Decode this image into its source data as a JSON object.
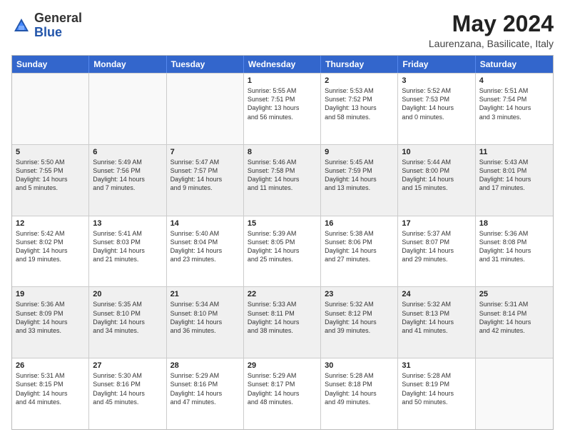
{
  "logo": {
    "general": "General",
    "blue": "Blue"
  },
  "title": "May 2024",
  "subtitle": "Laurenzana, Basilicate, Italy",
  "header_days": [
    "Sunday",
    "Monday",
    "Tuesday",
    "Wednesday",
    "Thursday",
    "Friday",
    "Saturday"
  ],
  "rows": [
    [
      {
        "day": "",
        "info": "",
        "empty": true
      },
      {
        "day": "",
        "info": "",
        "empty": true
      },
      {
        "day": "",
        "info": "",
        "empty": true
      },
      {
        "day": "1",
        "info": "Sunrise: 5:55 AM\nSunset: 7:51 PM\nDaylight: 13 hours\nand 56 minutes."
      },
      {
        "day": "2",
        "info": "Sunrise: 5:53 AM\nSunset: 7:52 PM\nDaylight: 13 hours\nand 58 minutes."
      },
      {
        "day": "3",
        "info": "Sunrise: 5:52 AM\nSunset: 7:53 PM\nDaylight: 14 hours\nand 0 minutes."
      },
      {
        "day": "4",
        "info": "Sunrise: 5:51 AM\nSunset: 7:54 PM\nDaylight: 14 hours\nand 3 minutes."
      }
    ],
    [
      {
        "day": "5",
        "info": "Sunrise: 5:50 AM\nSunset: 7:55 PM\nDaylight: 14 hours\nand 5 minutes."
      },
      {
        "day": "6",
        "info": "Sunrise: 5:49 AM\nSunset: 7:56 PM\nDaylight: 14 hours\nand 7 minutes."
      },
      {
        "day": "7",
        "info": "Sunrise: 5:47 AM\nSunset: 7:57 PM\nDaylight: 14 hours\nand 9 minutes."
      },
      {
        "day": "8",
        "info": "Sunrise: 5:46 AM\nSunset: 7:58 PM\nDaylight: 14 hours\nand 11 minutes."
      },
      {
        "day": "9",
        "info": "Sunrise: 5:45 AM\nSunset: 7:59 PM\nDaylight: 14 hours\nand 13 minutes."
      },
      {
        "day": "10",
        "info": "Sunrise: 5:44 AM\nSunset: 8:00 PM\nDaylight: 14 hours\nand 15 minutes."
      },
      {
        "day": "11",
        "info": "Sunrise: 5:43 AM\nSunset: 8:01 PM\nDaylight: 14 hours\nand 17 minutes."
      }
    ],
    [
      {
        "day": "12",
        "info": "Sunrise: 5:42 AM\nSunset: 8:02 PM\nDaylight: 14 hours\nand 19 minutes."
      },
      {
        "day": "13",
        "info": "Sunrise: 5:41 AM\nSunset: 8:03 PM\nDaylight: 14 hours\nand 21 minutes."
      },
      {
        "day": "14",
        "info": "Sunrise: 5:40 AM\nSunset: 8:04 PM\nDaylight: 14 hours\nand 23 minutes."
      },
      {
        "day": "15",
        "info": "Sunrise: 5:39 AM\nSunset: 8:05 PM\nDaylight: 14 hours\nand 25 minutes."
      },
      {
        "day": "16",
        "info": "Sunrise: 5:38 AM\nSunset: 8:06 PM\nDaylight: 14 hours\nand 27 minutes."
      },
      {
        "day": "17",
        "info": "Sunrise: 5:37 AM\nSunset: 8:07 PM\nDaylight: 14 hours\nand 29 minutes."
      },
      {
        "day": "18",
        "info": "Sunrise: 5:36 AM\nSunset: 8:08 PM\nDaylight: 14 hours\nand 31 minutes."
      }
    ],
    [
      {
        "day": "19",
        "info": "Sunrise: 5:36 AM\nSunset: 8:09 PM\nDaylight: 14 hours\nand 33 minutes."
      },
      {
        "day": "20",
        "info": "Sunrise: 5:35 AM\nSunset: 8:10 PM\nDaylight: 14 hours\nand 34 minutes."
      },
      {
        "day": "21",
        "info": "Sunrise: 5:34 AM\nSunset: 8:10 PM\nDaylight: 14 hours\nand 36 minutes."
      },
      {
        "day": "22",
        "info": "Sunrise: 5:33 AM\nSunset: 8:11 PM\nDaylight: 14 hours\nand 38 minutes."
      },
      {
        "day": "23",
        "info": "Sunrise: 5:32 AM\nSunset: 8:12 PM\nDaylight: 14 hours\nand 39 minutes."
      },
      {
        "day": "24",
        "info": "Sunrise: 5:32 AM\nSunset: 8:13 PM\nDaylight: 14 hours\nand 41 minutes."
      },
      {
        "day": "25",
        "info": "Sunrise: 5:31 AM\nSunset: 8:14 PM\nDaylight: 14 hours\nand 42 minutes."
      }
    ],
    [
      {
        "day": "26",
        "info": "Sunrise: 5:31 AM\nSunset: 8:15 PM\nDaylight: 14 hours\nand 44 minutes."
      },
      {
        "day": "27",
        "info": "Sunrise: 5:30 AM\nSunset: 8:16 PM\nDaylight: 14 hours\nand 45 minutes."
      },
      {
        "day": "28",
        "info": "Sunrise: 5:29 AM\nSunset: 8:16 PM\nDaylight: 14 hours\nand 47 minutes."
      },
      {
        "day": "29",
        "info": "Sunrise: 5:29 AM\nSunset: 8:17 PM\nDaylight: 14 hours\nand 48 minutes."
      },
      {
        "day": "30",
        "info": "Sunrise: 5:28 AM\nSunset: 8:18 PM\nDaylight: 14 hours\nand 49 minutes."
      },
      {
        "day": "31",
        "info": "Sunrise: 5:28 AM\nSunset: 8:19 PM\nDaylight: 14 hours\nand 50 minutes."
      },
      {
        "day": "",
        "info": "",
        "empty": true
      }
    ]
  ]
}
